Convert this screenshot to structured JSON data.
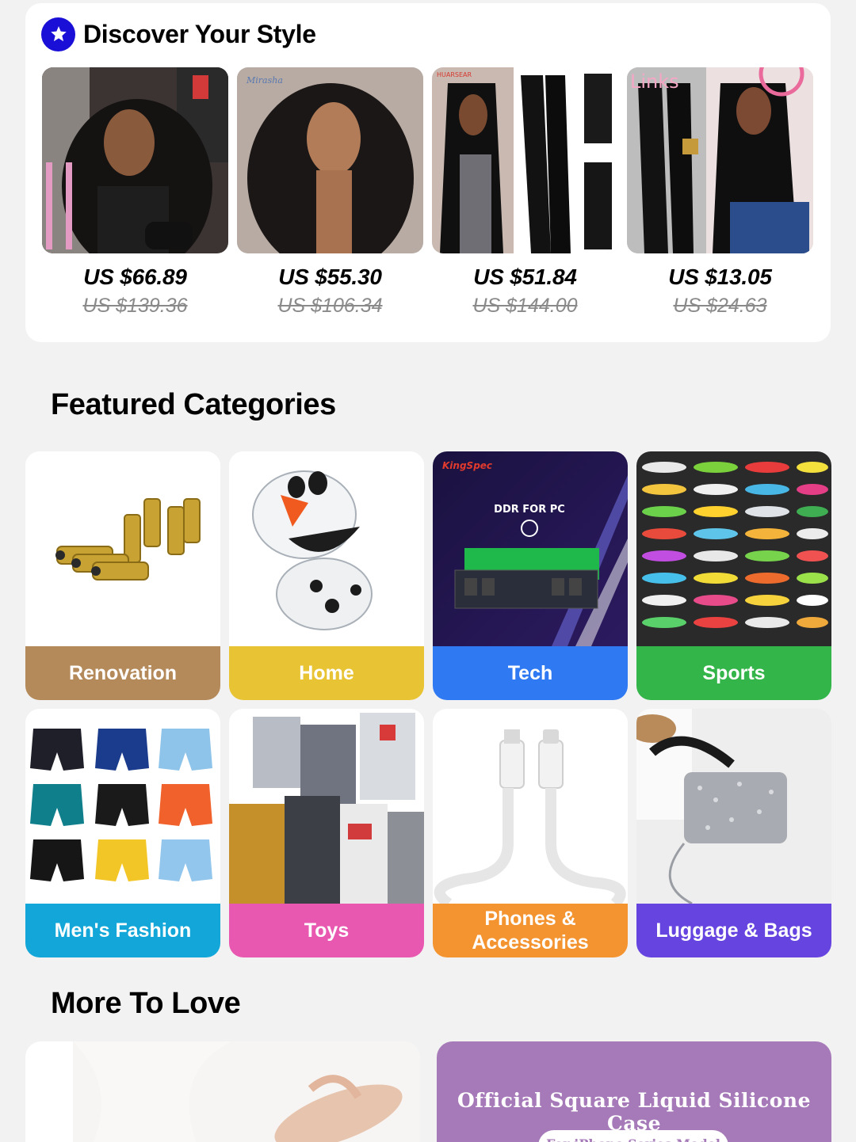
{
  "discover": {
    "title": "Discover Your Style",
    "badge_icon": "star-icon",
    "products": [
      {
        "price": "US $66.89",
        "original_price": "US $139.36",
        "image": "curly-lace-wig-photo"
      },
      {
        "price": "US $55.30",
        "original_price": "US $106.34",
        "image": "deep-wave-wig-photo"
      },
      {
        "price": "US $51.84",
        "original_price": "US $144.00",
        "image": "straight-hair-bundles-photo"
      },
      {
        "price": "US $13.05",
        "original_price": "US $24.63",
        "image": "straight-wig-photo"
      }
    ]
  },
  "featured": {
    "title": "Featured Categories",
    "categories": [
      {
        "label": "Renovation",
        "color": "#b58a5a"
      },
      {
        "label": "Home",
        "color": "#e8c435"
      },
      {
        "label": "Tech",
        "color": "#2f7af2"
      },
      {
        "label": "Sports",
        "color": "#34b54a"
      },
      {
        "label": "Men's Fashion",
        "color": "#12a7d8"
      },
      {
        "label": "Toys",
        "color": "#e858b0"
      },
      {
        "label": "Phones & Accessories",
        "color": "#f49431"
      },
      {
        "label": "Luggage & Bags",
        "color": "#6644e0"
      }
    ],
    "tech_banner": {
      "brand": "KingSpec",
      "text": "DDR FOR PC"
    }
  },
  "more_to_love": {
    "title": "More To Love",
    "right_banner_text": "Official Square Liquid Silicone Case",
    "right_banner_pill": "For iPhone Series Model"
  }
}
